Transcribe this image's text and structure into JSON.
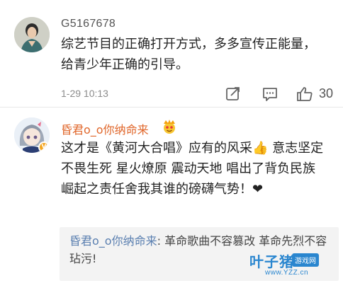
{
  "comments": [
    {
      "username": "G5167678",
      "text": "综艺节目的正确打开方式，多多宣传正能量，给青少年正确的引导。",
      "time": "1-29 10:13",
      "likes": "30"
    },
    {
      "username": "昏君o_o你纳命来",
      "text": "这才是《黄河大合唱》应有的风采👍 意志坚定 不畏生死 星火燎原 震动天地 唱出了背负民族崛起之责任舍我其谁的磅礴气势！❤",
      "reply": {
        "username": "昏君o_o你纳命来",
        "separator": ": ",
        "text": "革命歌曲不容篡改 革命先烈不容玷污!"
      }
    }
  ],
  "watermark": {
    "logo": "叶子猪",
    "tag": "游戏网",
    "url": "www.YZZ.cn"
  },
  "colors": {
    "username_vip": "#e0662a",
    "reply_user": "#5a7fb0",
    "meta_gray": "#8c8c8c",
    "watermark_blue": "#2a86cf"
  }
}
